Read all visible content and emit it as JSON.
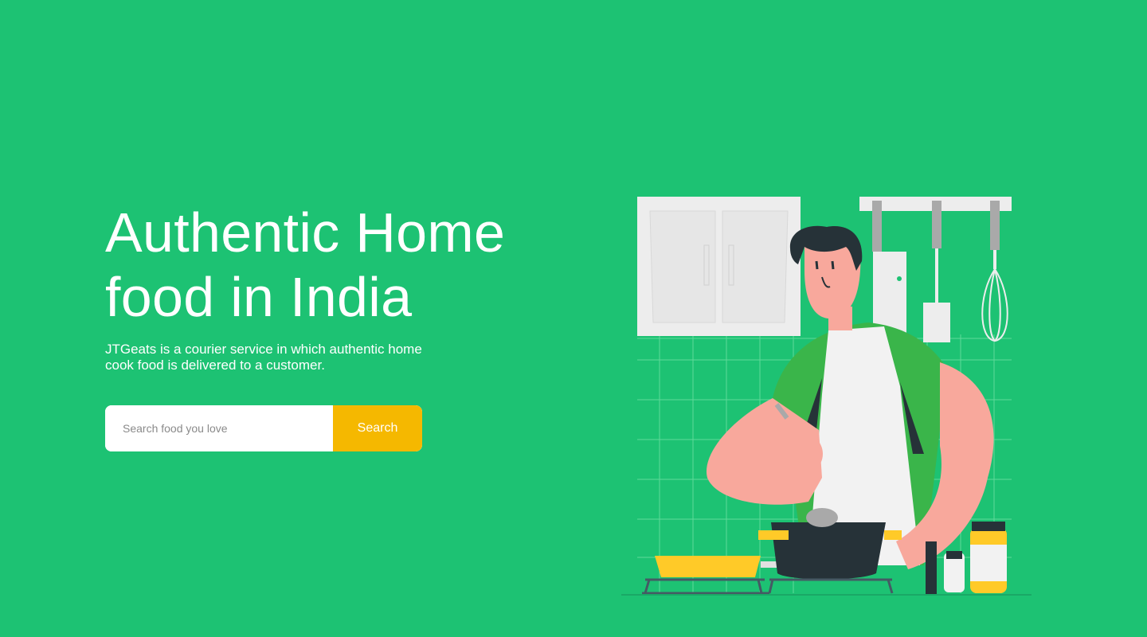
{
  "hero": {
    "title_line1": "Authentic Home",
    "title_line2": "food in India",
    "subtitle": "JTGeats is a courier service in which authentic home cook food is delivered to a customer."
  },
  "search": {
    "placeholder": "Search food you love",
    "value": "",
    "button_label": "Search"
  },
  "colors": {
    "background": "#1dc273",
    "accent": "#f5b800",
    "text": "#ffffff"
  },
  "illustration": {
    "subject": "chef-cooking-illustration"
  }
}
